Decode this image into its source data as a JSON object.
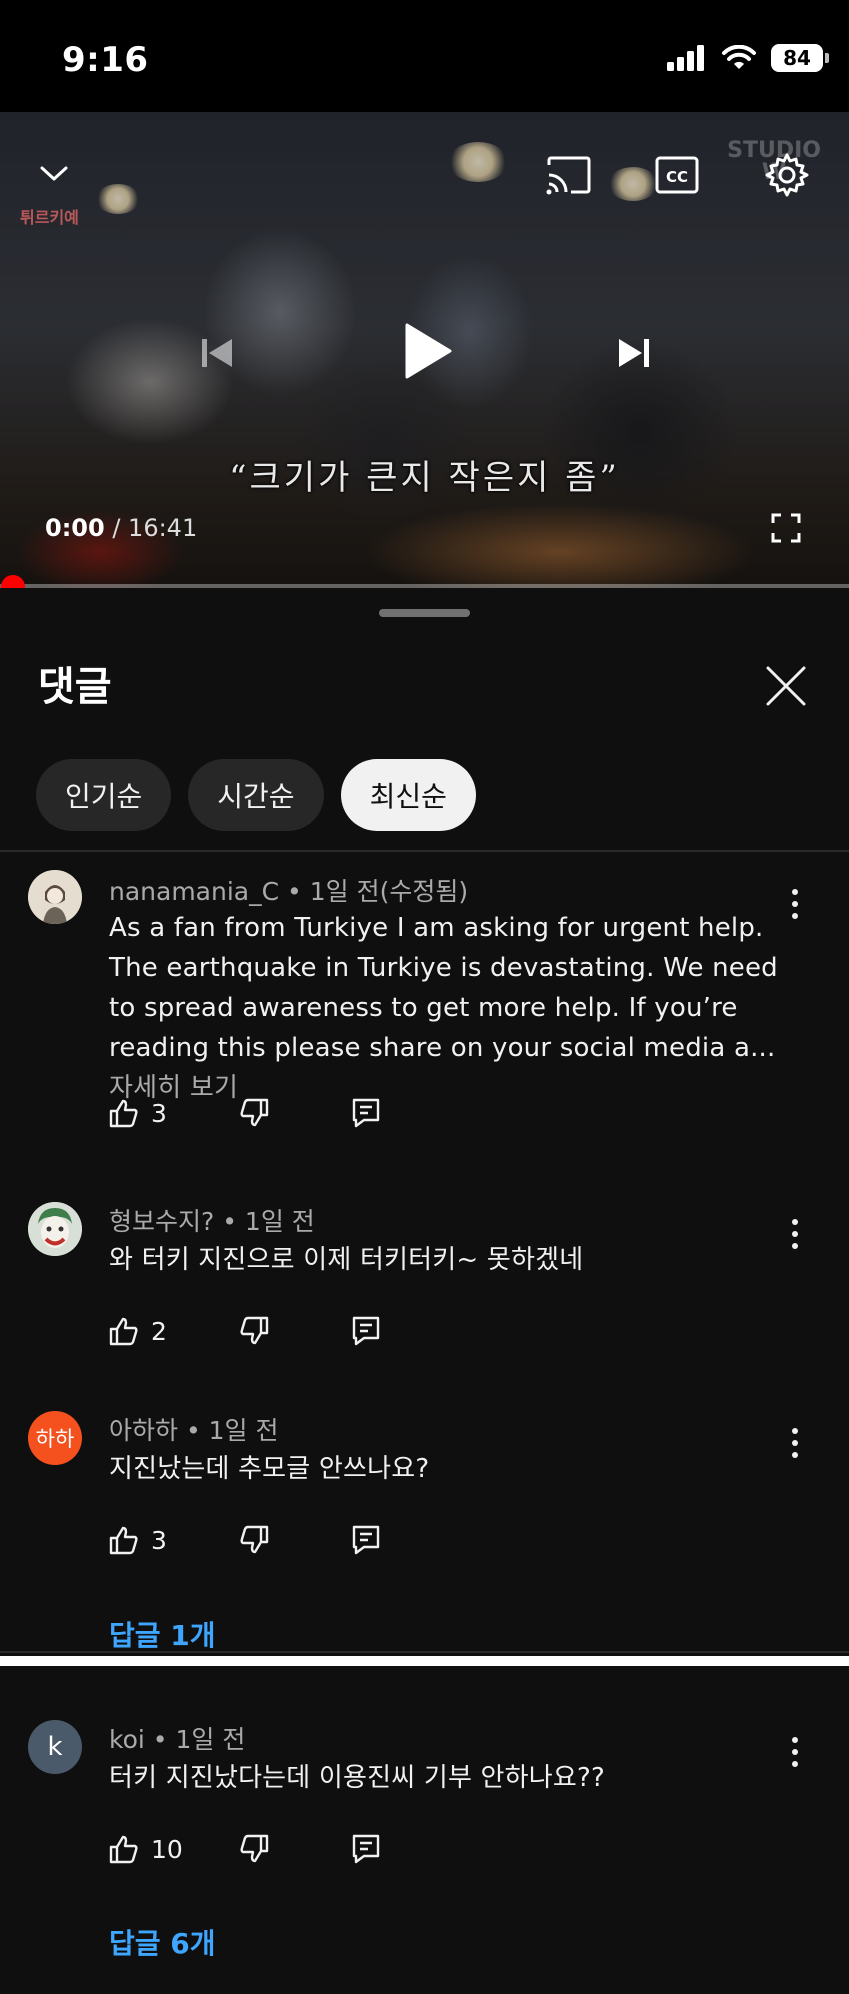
{
  "status_bar": {
    "time": "9:16",
    "battery": "84"
  },
  "video": {
    "subtitle": "“크기가 큰지 작은지 좀”",
    "current_time": "0:00",
    "separator": " / ",
    "duration": "16:41",
    "progress_percent": 0,
    "channel_watermark": "튀르키예 ",
    "studio_watermark_line1": "STUDIO",
    "studio_watermark_line2": "W"
  },
  "panel": {
    "title": "댓글",
    "chips": [
      {
        "label": "인기순",
        "active": false
      },
      {
        "label": "시간순",
        "active": false
      },
      {
        "label": "최신순",
        "active": true
      }
    ]
  },
  "comments": [
    {
      "author": "nanamania_C",
      "time": " • 1일 전(수정됨)",
      "text": "As a fan from Turkiye I am asking for urgent help. The earthquake in Turkiye is devastating. We need to spread awareness to get more help. If you’re reading this please share on your social media a...",
      "more": " 자세히 보기",
      "likes": "3",
      "avatar_text": ""
    },
    {
      "author": "형보수지?",
      "time": " • 1일 전",
      "text": "와 터키 지진으로 이제 터키터키~ 못하겠네",
      "likes": "2",
      "avatar_text": ""
    },
    {
      "author": "아하하",
      "time": " • 1일 전",
      "text": "지진났는데 추모글 안쓰나요?",
      "likes": "3",
      "avatar_text": "하하",
      "replies": "답글 1개"
    },
    {
      "author": "koi",
      "time": " • 1일 전",
      "text": "터키 지진났다는데 이용진씨 기부 안하나요??",
      "likes": "10",
      "avatar_text": "k",
      "replies": "답글 6개"
    }
  ],
  "colors": {
    "background": "#0f0f0f",
    "progress": "#ff0000",
    "link": "#3ea6ff",
    "avatar_orange": "#f4511e",
    "avatar_slate": "#4a5a6a"
  }
}
